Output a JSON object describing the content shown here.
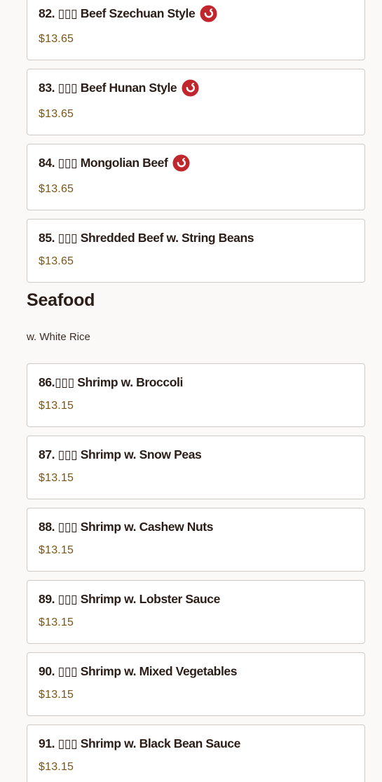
{
  "colors": {
    "background": "#faf9f7",
    "card_border": "#cfcac6",
    "name_text": "#2b1d17",
    "price_text": "#7a5618",
    "spicy_icon": "#c0272d"
  },
  "items_top": [
    {
      "name": "82. ▯▯▯ Beef Szechuan Style",
      "price": "$13.65",
      "spicy": true,
      "icon": "spicy-pepper-icon"
    },
    {
      "name": "83. ▯▯▯ Beef Hunan Style",
      "price": "$13.65",
      "spicy": true,
      "icon": "spicy-pepper-icon"
    },
    {
      "name": "84. ▯▯▯ Mongolian Beef",
      "price": "$13.65",
      "spicy": true,
      "icon": "spicy-pepper-icon"
    },
    {
      "name": "85. ▯▯▯ Shredded Beef w. String Beans",
      "price": "$13.65",
      "spicy": false
    }
  ],
  "section": {
    "title": "Seafood",
    "subtitle": "w. White Rice"
  },
  "items_seafood": [
    {
      "name": "86.▯▯▯ Shrimp w. Broccoli",
      "price": "$13.15"
    },
    {
      "name": "87. ▯▯▯ Shrimp w. Snow Peas",
      "price": "$13.15"
    },
    {
      "name": "88. ▯▯▯ Shrimp w. Cashew Nuts",
      "price": "$13.15"
    },
    {
      "name": "89. ▯▯▯ Shrimp w. Lobster Sauce",
      "price": "$13.15"
    },
    {
      "name": "90. ▯▯▯ Shrimp w. Mixed Vegetables",
      "price": "$13.15"
    },
    {
      "name": "91. ▯▯▯ Shrimp w. Black Bean Sauce",
      "price": "$13.15"
    }
  ]
}
